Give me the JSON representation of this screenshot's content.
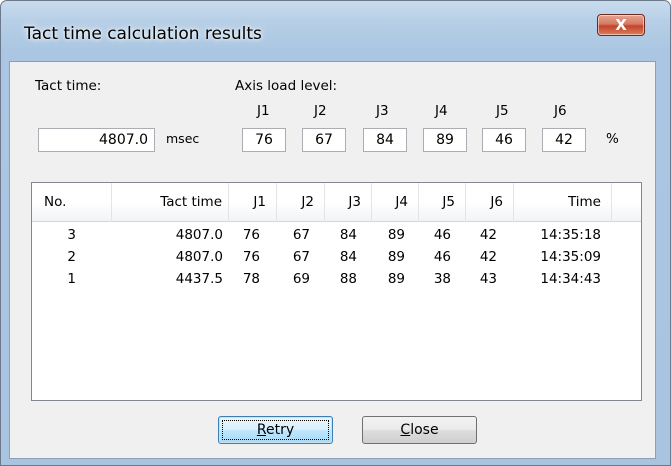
{
  "window": {
    "title": "Tact time calculation results",
    "close_glyph": "X"
  },
  "tact": {
    "label": "Tact time:",
    "value": "4807.0",
    "unit": "msec"
  },
  "axis": {
    "label": "Axis load level:",
    "joints": [
      "J1",
      "J2",
      "J3",
      "J4",
      "J5",
      "J6"
    ],
    "values": [
      "76",
      "67",
      "84",
      "89",
      "46",
      "42"
    ],
    "unit": "%"
  },
  "table": {
    "headers": [
      "No.",
      "Tact time",
      "J1",
      "J2",
      "J3",
      "J4",
      "J5",
      "J6",
      "Time"
    ],
    "rows": [
      [
        "3",
        "4807.0",
        "76",
        "67",
        "84",
        "89",
        "46",
        "42",
        "14:35:18"
      ],
      [
        "2",
        "4807.0",
        "76",
        "67",
        "84",
        "89",
        "46",
        "42",
        "14:35:09"
      ],
      [
        "1",
        "4437.5",
        "78",
        "69",
        "88",
        "89",
        "38",
        "43",
        "14:34:43"
      ]
    ]
  },
  "buttons": {
    "retry": {
      "mnemonic": "R",
      "rest": "etry"
    },
    "close": {
      "mnemonic": "C",
      "rest": "lose"
    }
  }
}
